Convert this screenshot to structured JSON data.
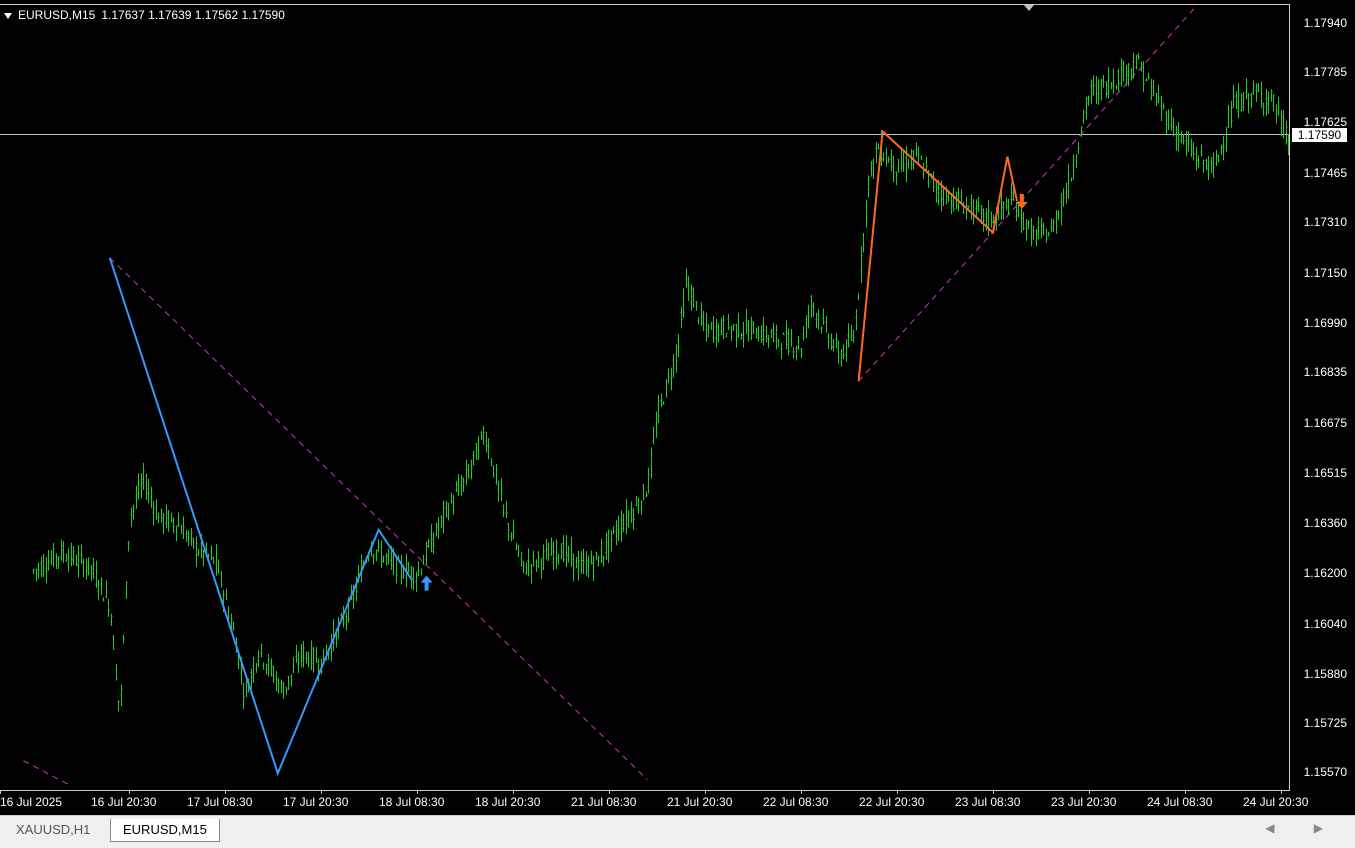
{
  "header": {
    "symbol": "EURUSD,M15",
    "ohlc": "1.17637 1.17639 1.17562 1.17590"
  },
  "price_axis": [
    "1.17940",
    "1.17785",
    "1.17625",
    "1.17465",
    "1.17310",
    "1.17150",
    "1.16990",
    "1.16835",
    "1.16675",
    "1.16515",
    "1.16360",
    "1.16200",
    "1.16040",
    "1.15880",
    "1.15725",
    "1.15570"
  ],
  "current_price": "1.17590",
  "time_axis": [
    "16 Jul 2025",
    "16 Jul 20:30",
    "17 Jul 08:30",
    "17 Jul 20:30",
    "18 Jul 08:30",
    "18 Jul 20:30",
    "21 Jul 08:30",
    "21 Jul 20:30",
    "22 Jul 08:30",
    "22 Jul 20:30",
    "23 Jul 08:30",
    "23 Jul 20:30",
    "24 Jul 08:30",
    "24 Jul 20:30"
  ],
  "tabs": [
    {
      "label": "XAUUSD,H1",
      "active": false
    },
    {
      "label": "EURUSD,M15",
      "active": true
    }
  ],
  "scroll_arrows": "◀ ▶",
  "colors": {
    "candle": "#22cc22",
    "bull_pattern": "#3399ff",
    "bear_pattern": "#ff6a1a",
    "trendline": "#cc33cc",
    "price_line": "#c0c0c0"
  },
  "chart_data": {
    "type": "bar",
    "symbol": "EURUSD",
    "timeframe": "M15",
    "ylim": [
      1.1553,
      1.1799
    ],
    "x_labels": [
      "16 Jul 2025",
      "16 Jul 20:30",
      "17 Jul 08:30",
      "17 Jul 20:30",
      "18 Jul 08:30",
      "18 Jul 20:30",
      "21 Jul 08:30",
      "21 Jul 20:30",
      "22 Jul 08:30",
      "22 Jul 20:30",
      "23 Jul 08:30",
      "23 Jul 20:30",
      "24 Jul 08:30",
      "24 Jul 20:30"
    ],
    "y_ticks": [
      1.1794,
      1.17785,
      1.17625,
      1.17465,
      1.1731,
      1.1715,
      1.1699,
      1.16835,
      1.16675,
      1.16515,
      1.1636,
      1.162,
      1.1604,
      1.1588,
      1.15725,
      1.1557
    ],
    "current_price": 1.1759,
    "price_path": [
      [
        0,
        1.1621
      ],
      [
        0.3,
        1.1627
      ],
      [
        0.6,
        1.1622
      ],
      [
        0.8,
        1.161
      ],
      [
        0.9,
        1.1575
      ],
      [
        1.0,
        1.1638
      ],
      [
        1.15,
        1.165
      ],
      [
        1.3,
        1.1638
      ],
      [
        1.5,
        1.1636
      ],
      [
        1.7,
        1.1628
      ],
      [
        1.9,
        1.1624
      ],
      [
        2.1,
        1.16
      ],
      [
        2.2,
        1.1582
      ],
      [
        2.35,
        1.1596
      ],
      [
        2.6,
        1.1583
      ],
      [
        2.8,
        1.1595
      ],
      [
        3.0,
        1.1592
      ],
      [
        3.3,
        1.161
      ],
      [
        3.5,
        1.1629
      ],
      [
        3.8,
        1.1622
      ],
      [
        4.0,
        1.162
      ],
      [
        4.1,
        1.1627
      ],
      [
        4.3,
        1.164
      ],
      [
        4.5,
        1.165
      ],
      [
        4.7,
        1.1665
      ],
      [
        4.9,
        1.164
      ],
      [
        5.1,
        1.1622
      ],
      [
        5.3,
        1.1625
      ],
      [
        5.5,
        1.1628
      ],
      [
        5.7,
        1.1622
      ],
      [
        5.9,
        1.1625
      ],
      [
        6.1,
        1.1635
      ],
      [
        6.3,
        1.1642
      ],
      [
        6.4,
        1.1648
      ],
      [
        6.5,
        1.167
      ],
      [
        6.7,
        1.169
      ],
      [
        6.8,
        1.1712
      ],
      [
        7.0,
        1.1697
      ],
      [
        7.2,
        1.1698
      ],
      [
        7.5,
        1.1697
      ],
      [
        7.8,
        1.1694
      ],
      [
        8.0,
        1.1692
      ],
      [
        8.1,
        1.1706
      ],
      [
        8.2,
        1.17
      ],
      [
        8.4,
        1.1689
      ],
      [
        8.55,
        1.1695
      ],
      [
        8.7,
        1.1745
      ],
      [
        8.8,
        1.1755
      ],
      [
        9.0,
        1.1748
      ],
      [
        9.2,
        1.1752
      ],
      [
        9.4,
        1.1742
      ],
      [
        9.6,
        1.1738
      ],
      [
        9.8,
        1.1735
      ],
      [
        9.95,
        1.1732
      ],
      [
        10.2,
        1.1738
      ],
      [
        10.4,
        1.1727
      ],
      [
        10.6,
        1.1728
      ],
      [
        10.8,
        1.1745
      ],
      [
        11.0,
        1.1772
      ],
      [
        11.2,
        1.1775
      ],
      [
        11.5,
        1.1782
      ],
      [
        11.7,
        1.177
      ],
      [
        11.9,
        1.176
      ],
      [
        12.1,
        1.1752
      ],
      [
        12.3,
        1.1748
      ],
      [
        12.5,
        1.1768
      ],
      [
        12.7,
        1.1772
      ],
      [
        12.9,
        1.177
      ],
      [
        13.1,
        1.1755
      ],
      [
        13.3,
        1.1748
      ]
    ],
    "patterns": [
      {
        "name": "bullish",
        "points": [
          [
            0.8,
            1.172
          ],
          [
            2.55,
            1.1557
          ],
          [
            3.6,
            1.1634
          ],
          [
            3.95,
            1.1618
          ]
        ]
      },
      {
        "name": "bearish",
        "points": [
          [
            8.6,
            1.1681
          ],
          [
            8.85,
            1.176
          ],
          [
            10.0,
            1.1728
          ],
          [
            10.15,
            1.1752
          ],
          [
            10.25,
            1.1738
          ]
        ]
      }
    ],
    "trendlines": [
      {
        "name": "descending",
        "from": [
          0.8,
          1.172
        ],
        "to": [
          6.4,
          1.1555
        ]
      },
      {
        "name": "ascending",
        "from": [
          8.6,
          1.1681
        ],
        "to": [
          12.1,
          1.1799
        ]
      },
      {
        "name": "lower-left",
        "from": [
          -0.1,
          1.1561
        ],
        "to": [
          0.4,
          1.1553
        ]
      }
    ],
    "arrows": [
      {
        "type": "buy",
        "at": [
          4.1,
          1.1617
        ]
      },
      {
        "type": "sell",
        "at": [
          10.3,
          1.1738
        ]
      }
    ]
  }
}
